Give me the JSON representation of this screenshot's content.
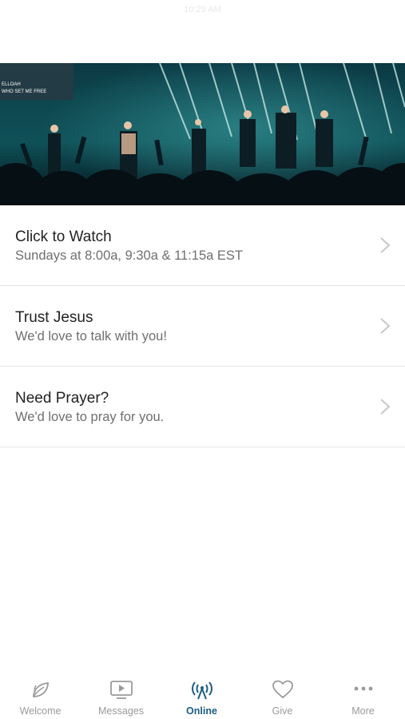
{
  "status_bar": {
    "time": "10:29 AM"
  },
  "hero": {
    "screen_text_line1": "ELLOAH",
    "screen_text_line2": "WHO SET ME FREE"
  },
  "items": [
    {
      "title": "Click to Watch",
      "subtitle": "Sundays at 8:00a, 9:30a & 11:15a EST"
    },
    {
      "title": "Trust Jesus",
      "subtitle": "We'd love to talk with you!"
    },
    {
      "title": "Need Prayer?",
      "subtitle": "We'd love to pray for you."
    }
  ],
  "tabs": [
    {
      "label": "Welcome",
      "icon": "leaf-icon"
    },
    {
      "label": "Messages",
      "icon": "video-play-icon"
    },
    {
      "label": "Online",
      "icon": "broadcast-icon",
      "active": true
    },
    {
      "label": "Give",
      "icon": "heart-icon"
    },
    {
      "label": "More",
      "icon": "ellipsis-icon"
    }
  ],
  "colors": {
    "active_tab": "#1d5c83",
    "inactive_tab": "#9a9a9a"
  }
}
